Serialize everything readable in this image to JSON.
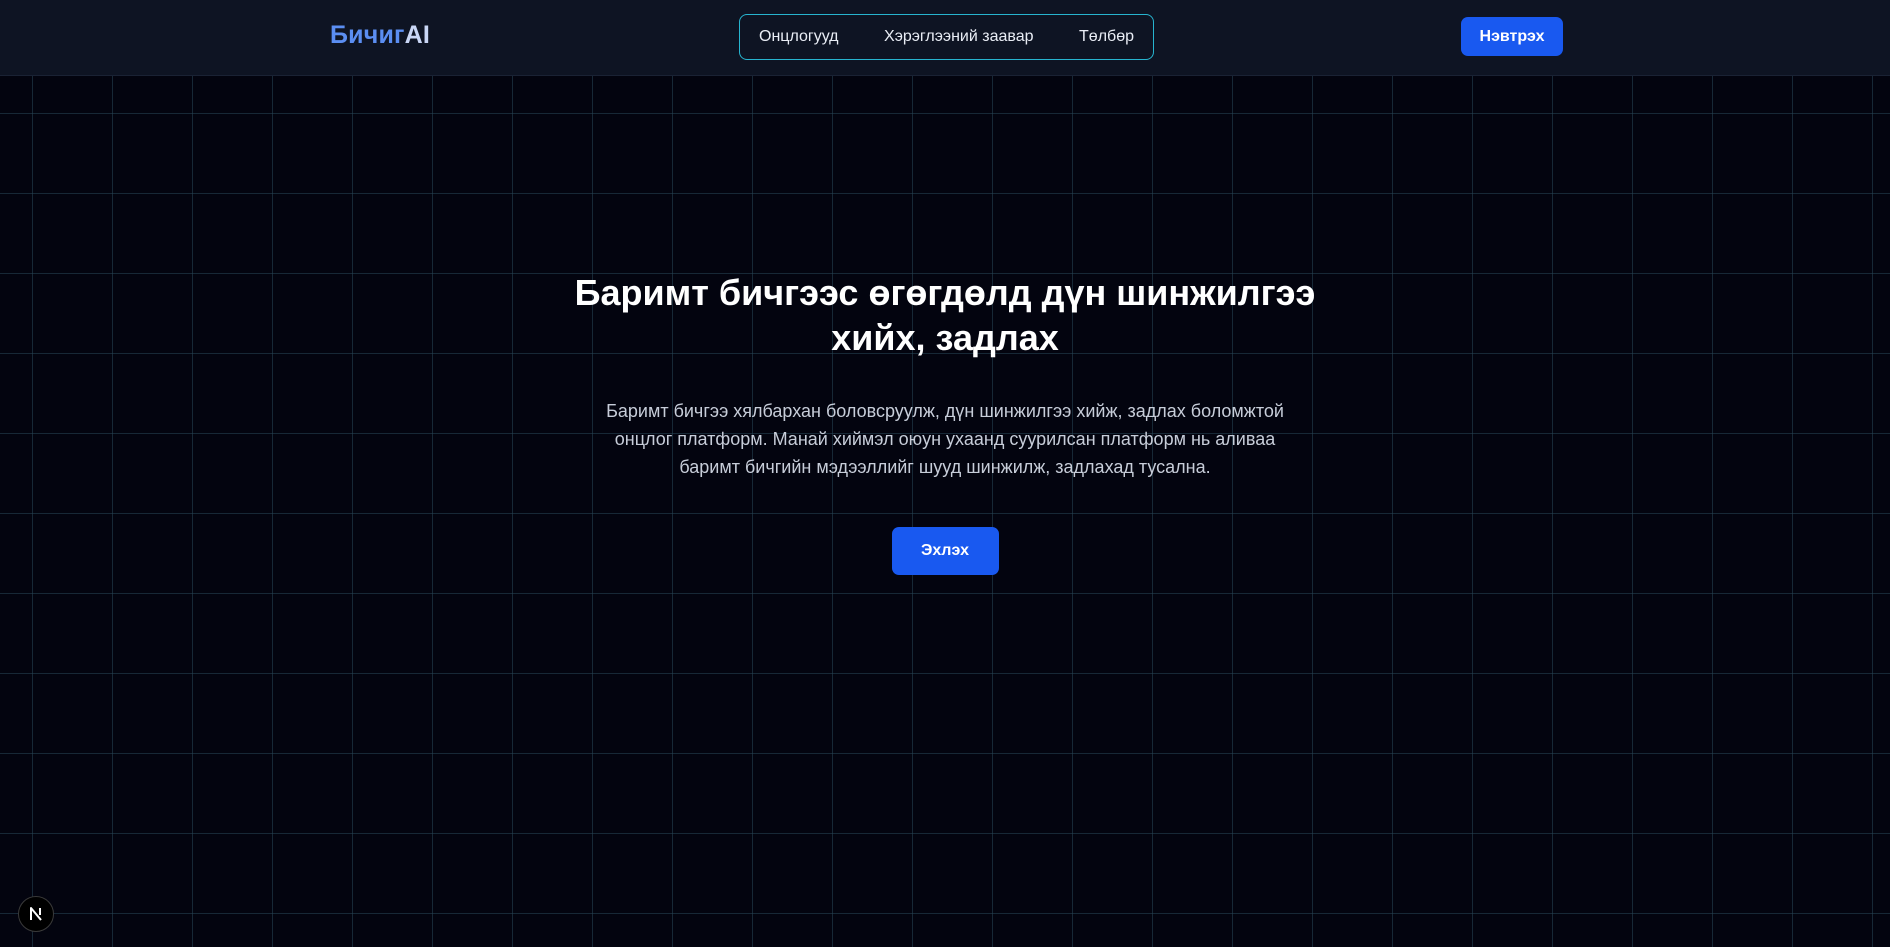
{
  "header": {
    "logo_main": "Бичиг",
    "logo_accent": "AI",
    "nav": [
      {
        "label": "Онцлогууд"
      },
      {
        "label": "Хэрэглээний заавар"
      },
      {
        "label": "Төлбөр"
      }
    ],
    "login_label": "Нэвтрэх"
  },
  "hero": {
    "title_line1": "Баримт бичгээс өгөгдөлд дүн шинжилгээ",
    "title_line2": "хийх, задлах",
    "desc_line1": "Баримт бичгээ хялбархан боловсруулж, дүн шинжилгээ хийж, задлах боломжтой",
    "desc_line2": "онцлог платформ. Манай хиймэл оюун ухаанд суурилсан платформ нь аливаа",
    "desc_line3": "баримт бичгийн мэдээллийг шууд шинжилж, задлахад тусална.",
    "cta_label": "Эхлэх"
  },
  "dev_badge": {
    "icon": "nextjs-n-icon",
    "glyph": "N"
  },
  "colors": {
    "background": "#03040f",
    "topbar": "#0e1423",
    "accent_blue": "#1959f0",
    "nav_border": "#27b4cf",
    "logo_blue": "#5b8ef2"
  }
}
